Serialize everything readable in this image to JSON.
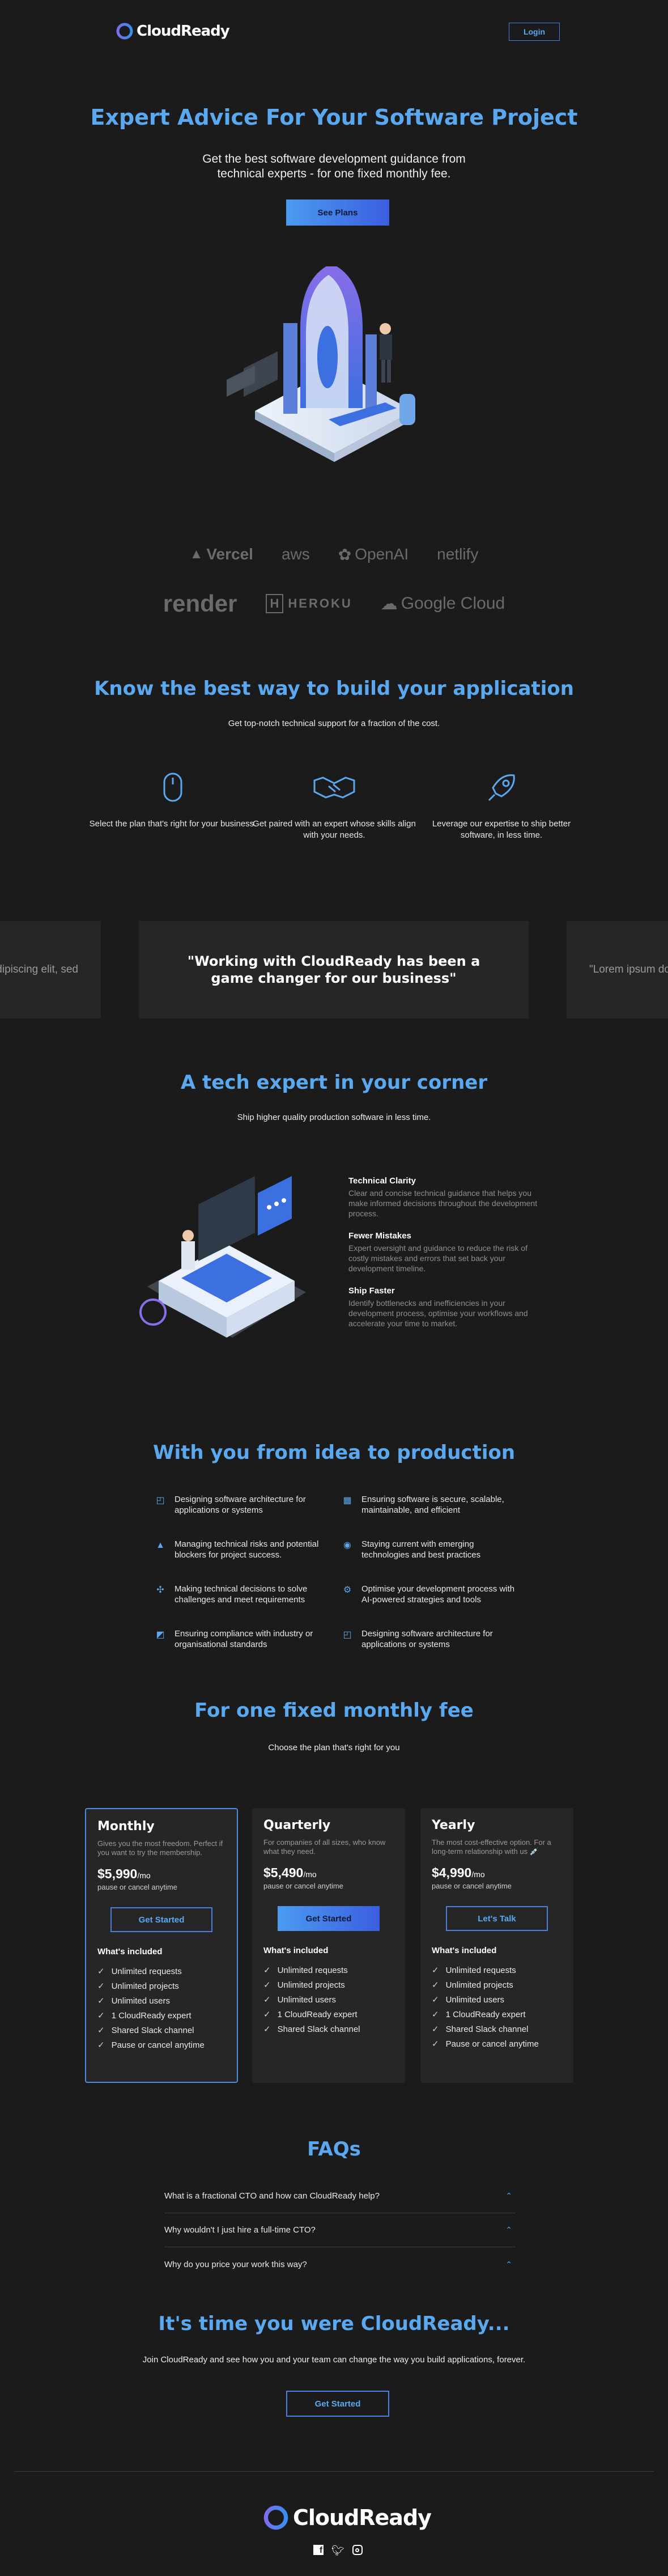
{
  "header": {
    "brand": "CloudReady",
    "login_label": "Login"
  },
  "hero": {
    "title": "Expert Advice For Your Software Project",
    "subtitle_line1": "Get the best software development guidance from",
    "subtitle_line2": "technical experts - for one fixed monthly fee.",
    "cta_label": "See Plans"
  },
  "logos": {
    "row1": [
      "Vercel",
      "aws",
      "OpenAI",
      "netlify"
    ],
    "row2": [
      "render",
      "HEROKU",
      "Google Cloud"
    ]
  },
  "how": {
    "title": "Know the best way to build your application",
    "subtitle": "Get top-notch technical support for a fraction of the cost.",
    "steps": [
      {
        "icon": "mouse-icon",
        "text": "Select the plan that's right for your business."
      },
      {
        "icon": "handshake-icon",
        "text": "Get paired with an expert whose skills align with your needs."
      },
      {
        "icon": "rocket-icon",
        "text": "Leverage our expertise to ship better software, in less time."
      }
    ]
  },
  "testimonials": {
    "left": "dipiscing elit, sed",
    "main": "\"Working with CloudReady has been a game changer for our business\"",
    "right": "\"Lorem ipsum do"
  },
  "expert": {
    "title": "A tech expert in your corner",
    "subtitle": "Ship higher quality production software in less time.",
    "features": [
      {
        "title": "Technical Clarity",
        "desc": "Clear and concise technical guidance that helps you make informed decisions throughout the development process."
      },
      {
        "title": "Fewer Mistakes",
        "desc": "Expert oversight and guidance to reduce the risk of costly mistakes and errors that set back your development timeline."
      },
      {
        "title": "Ship Faster",
        "desc": "Identify bottlenecks and inefficiencies in your development process, optimise your workflows and accelerate your time to market."
      }
    ]
  },
  "services": {
    "title": "With you from idea to production",
    "items": [
      "Designing software architecture for applications or systems",
      "Ensuring software is secure, scalable, maintainable, and efficient",
      "Managing technical risks and potential blockers for project success.",
      "Staying current with emerging technologies and best practices",
      "Making technical decisions to solve challenges and meet requirements",
      "Optimise your development process with AI-powered strategies and tools",
      "Ensuring compliance with industry or organisational standards",
      "Designing software architecture for applications or systems"
    ]
  },
  "pricing": {
    "title": "For one fixed monthly fee",
    "subtitle": "Choose the plan that's right for you",
    "included_label": "What's included",
    "plans": [
      {
        "name": "Monthly",
        "desc": "Gives you the most freedom. Perfect if you want to try the membership.",
        "price": "$5,990",
        "per": "/mo",
        "note": "pause or cancel anytime",
        "cta": "Get Started",
        "features": [
          "Unlimited requests",
          "Unlimited projects",
          "Unlimited users",
          "1 CloudReady expert",
          "Shared Slack channel",
          "Pause or cancel anytime"
        ]
      },
      {
        "name": "Quarterly",
        "desc": "For companies of all sizes, who know what they need.",
        "price": "$5,490",
        "per": "/mo",
        "note": "pause or cancel anytime",
        "cta": "Get Started",
        "features": [
          "Unlimited requests",
          "Unlimited projects",
          "Unlimited users",
          "1 CloudReady expert",
          "Shared Slack channel"
        ]
      },
      {
        "name": "Yearly",
        "desc": "The most cost-effective option. For a long-term relationship with us 💉",
        "price": "$4,990",
        "per": "/mo",
        "note": "pause or cancel anytime",
        "cta": "Let's Talk",
        "features": [
          "Unlimited requests",
          "Unlimited projects",
          "Unlimited users",
          "1 CloudReady expert",
          "Shared Slack channel",
          "Pause or cancel anytime"
        ]
      }
    ]
  },
  "faqs": {
    "title": "FAQs",
    "items": [
      "What is a fractional CTO and how can CloudReady help?",
      "Why wouldn't I just hire a full-time CTO?",
      "Why do you price your work this way?"
    ]
  },
  "final_cta": {
    "title": "It's time you were CloudReady...",
    "subtitle": "Join CloudReady and see how you and your team can change the way you build applications, forever.",
    "button": "Get Started"
  },
  "footer": {
    "brand": "CloudReady",
    "social": [
      "facebook-icon",
      "twitter-icon",
      "instagram-icon"
    ]
  },
  "colors": {
    "accent": "#5aa9f0",
    "background": "#1b1b1b",
    "card": "#262626"
  }
}
